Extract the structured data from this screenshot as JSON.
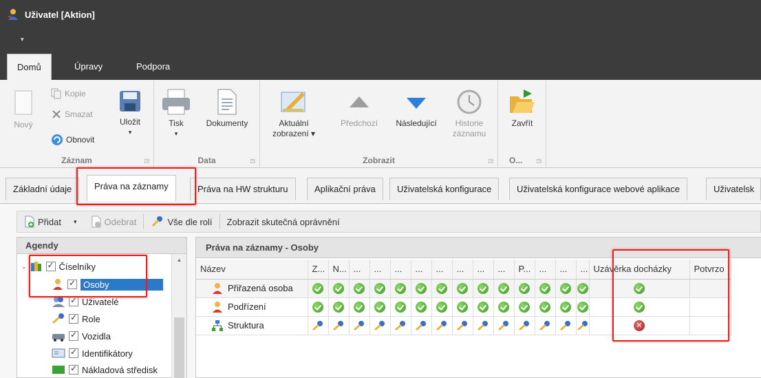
{
  "window": {
    "title": "Uživatel [Aktion]",
    "qat_arrow": "▾"
  },
  "ribbon_tabs": [
    "Domů",
    "Úpravy",
    "Podpora"
  ],
  "ribbon": {
    "zaznam": {
      "label": "Záznam",
      "new": "Nový",
      "copy": "Kopie",
      "delete": "Smazat",
      "refresh": "Obnovit",
      "save": "Uložit"
    },
    "data": {
      "label": "Data",
      "print": "Tisk",
      "documents": "Dokumenty"
    },
    "zobrazit": {
      "label": "Zobrazit",
      "current_view_1": "Aktuální",
      "current_view_2": "zobrazení ▾",
      "prev": "Předchozí",
      "next": "Následující",
      "history_1": "Historie",
      "history_2": "záznamu"
    },
    "other": {
      "label": "O...",
      "close": "Zavřít"
    }
  },
  "doc_tabs": [
    "Základní údaje",
    "Práva na záznamy",
    "Práva na HW strukturu",
    "Aplikační práva",
    "Uživatelská konfigurace",
    "Uživatelská konfigurace webové aplikace",
    "Uživatelsk"
  ],
  "toolbar": {
    "add": "Přidat",
    "remove": "Odebrat",
    "all_by_roles": "Vše dle rolí",
    "show_effective": "Zobrazit skutečná oprávnění"
  },
  "agendy": {
    "header": "Agendy",
    "items": [
      {
        "label": "Číselníky",
        "icon": "books-icon"
      },
      {
        "label": "Osoby",
        "icon": "person-icon"
      },
      {
        "label": "Uživatelé",
        "icon": "users-icon"
      },
      {
        "label": "Role",
        "icon": "key-icon"
      },
      {
        "label": "Vozidla",
        "icon": "vehicle-icon"
      },
      {
        "label": "Identifikátory",
        "icon": "card-icon"
      },
      {
        "label": "Nákladová středisk",
        "icon": "cost-icon"
      }
    ]
  },
  "grid": {
    "title": "Práva na záznamy - Osoby",
    "columns": [
      "Název",
      "Z...",
      "N...",
      "...",
      "...",
      "...",
      "...",
      "...",
      "...",
      "...",
      "...",
      "P...",
      "...",
      "...",
      "...",
      "Uzávěrka docházky",
      "Potvrzo"
    ],
    "rows": [
      {
        "name": "Přiřazená osoba",
        "icon": "person-icon",
        "cells": "ok",
        "uzaverka": "ok"
      },
      {
        "name": "Podřízení",
        "icon": "person-icon",
        "cells": "ok",
        "uzaverka": "ok"
      },
      {
        "name": "Struktura",
        "icon": "structure-icon",
        "cells": "key",
        "uzaverka": "err"
      }
    ]
  },
  "colors": {
    "highlight": "#e8201e",
    "selection": "#2b79c9",
    "titlebar": "#3c3c3c"
  }
}
